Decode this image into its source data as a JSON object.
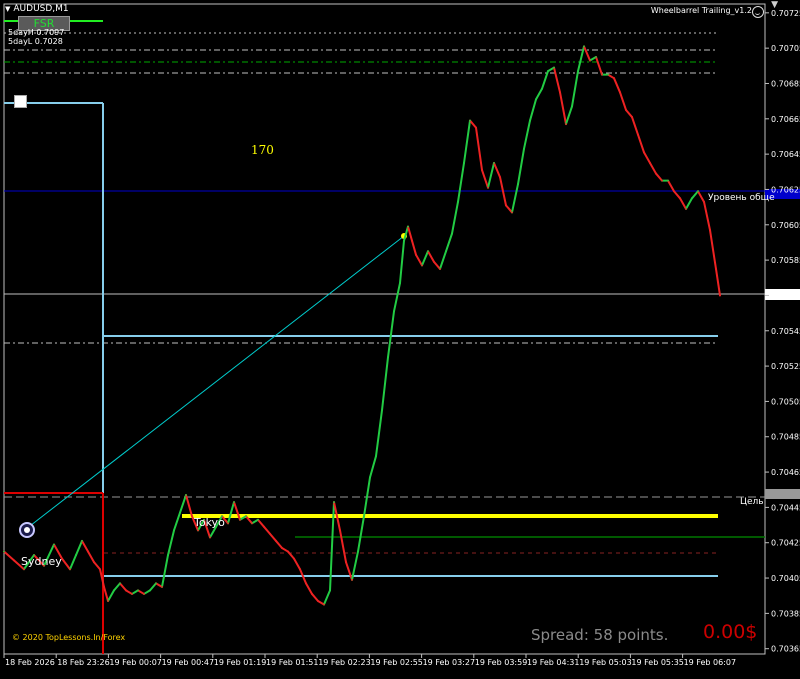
{
  "window": {
    "title": "AUDUSD,M1",
    "expert": "Wheelbarrel Trailing_v1.2",
    "fsr_label": "FSR",
    "sday_high": "5dayH 0.7097",
    "sday_low": "5dayL 0.7028",
    "count_label": "170",
    "copyright": "© 2020 TopLessons.In/Forex",
    "spread": "Spread: 58 points.",
    "profit": "0.00$",
    "session_sydney": "Sydney",
    "session_tokyo": "Tokyo",
    "line_label_level": "Уровень обще",
    "line_label_target": "Цель"
  },
  "colors": {
    "background": "#000000",
    "bull": "#22cc44",
    "bear": "#ee2222",
    "gray_line": "#c0c0c0",
    "level_line": "#0000cc",
    "light_blue": "#87ceeb",
    "tokyo_yellow": "#ffff00",
    "dark_green": "#007700",
    "red_box": "#dd0000"
  },
  "chart_data": {
    "type": "line",
    "symbol": "AUDUSD",
    "timeframe": "M1",
    "x_tick_labels": [
      "18 Feb 2026",
      "18 Feb 23:26",
      "19 Feb 00:07",
      "19 Feb 00:47",
      "19 Feb 01:19",
      "19 Feb 01:51",
      "19 Feb 02:23",
      "19 Feb 02:55",
      "19 Feb 03:27",
      "19 Feb 03:59",
      "19 Feb 04:31",
      "19 Feb 05:03",
      "19 Feb 05:35",
      "19 Feb 06:07"
    ],
    "y_tick_labels": [
      "0.70725",
      "0.70705",
      "0.70685",
      "0.70665",
      "0.70645",
      "0.70625",
      "0.70605",
      "0.70585",
      "0.70565",
      "0.70545",
      "0.70525",
      "0.70505",
      "0.70485",
      "0.70465",
      "0.70445",
      "0.70425",
      "0.70405",
      "0.70385",
      "0.70365"
    ],
    "ylim": [
      0.70362,
      0.7073
    ],
    "x": [
      0,
      10,
      20,
      30,
      40,
      50,
      58,
      66,
      72,
      78,
      84,
      90,
      96,
      100,
      104,
      110,
      116,
      122,
      128,
      134,
      140,
      146,
      152,
      158,
      164,
      170,
      176,
      182,
      188,
      194,
      200,
      206,
      212,
      218,
      224,
      230,
      236,
      242,
      248,
      254,
      260,
      266,
      272,
      278,
      284,
      290,
      296,
      302,
      308,
      314,
      320,
      326,
      330,
      336,
      342,
      348,
      354,
      360,
      366,
      372,
      378,
      384,
      390,
      396,
      400,
      404,
      408,
      412,
      418,
      424,
      430,
      436,
      442,
      448,
      454,
      460,
      466,
      472,
      478,
      484,
      490,
      496,
      502,
      508,
      514,
      520,
      526,
      532,
      538,
      544,
      550,
      556,
      562,
      568,
      574,
      580,
      586,
      592,
      598,
      604,
      610,
      616,
      622,
      628,
      634,
      640,
      646,
      652,
      658,
      664,
      670,
      676,
      682,
      688,
      694,
      700,
      706,
      712,
      716
    ],
    "values": [
      0.7042,
      0.70415,
      0.7041,
      0.70418,
      0.70412,
      0.70424,
      0.70416,
      0.7041,
      0.70418,
      0.70426,
      0.7042,
      0.70414,
      0.7041,
      0.704,
      0.70392,
      0.70398,
      0.70402,
      0.70398,
      0.70396,
      0.70398,
      0.70396,
      0.70398,
      0.70402,
      0.704,
      0.70418,
      0.70432,
      0.70442,
      0.70452,
      0.7044,
      0.70432,
      0.70438,
      0.70428,
      0.70434,
      0.7044,
      0.70436,
      0.70448,
      0.70438,
      0.7044,
      0.70436,
      0.70438,
      0.70434,
      0.7043,
      0.70426,
      0.70422,
      0.7042,
      0.70416,
      0.7041,
      0.70402,
      0.70396,
      0.70392,
      0.7039,
      0.70398,
      0.70448,
      0.70432,
      0.70414,
      0.70404,
      0.7042,
      0.7044,
      0.70462,
      0.70474,
      0.705,
      0.7053,
      0.70556,
      0.70572,
      0.70596,
      0.70604,
      0.70596,
      0.70588,
      0.70582,
      0.7059,
      0.70584,
      0.7058,
      0.7059,
      0.706,
      0.70618,
      0.7064,
      0.70664,
      0.7066,
      0.70636,
      0.70626,
      0.7064,
      0.70632,
      0.70616,
      0.70612,
      0.70628,
      0.70648,
      0.70664,
      0.70676,
      0.70682,
      0.70692,
      0.70694,
      0.7068,
      0.70662,
      0.70672,
      0.70692,
      0.70706,
      0.70698,
      0.707,
      0.7069,
      0.7069,
      0.70688,
      0.7068,
      0.7067,
      0.70666,
      0.70656,
      0.70646,
      0.7064,
      0.70634,
      0.7063,
      0.7063,
      0.70624,
      0.7062,
      0.70614,
      0.7062,
      0.70624,
      0.70618,
      0.70602,
      0.7058,
      0.70565
    ],
    "xlabel": "",
    "ylabel": "",
    "grid": false
  }
}
